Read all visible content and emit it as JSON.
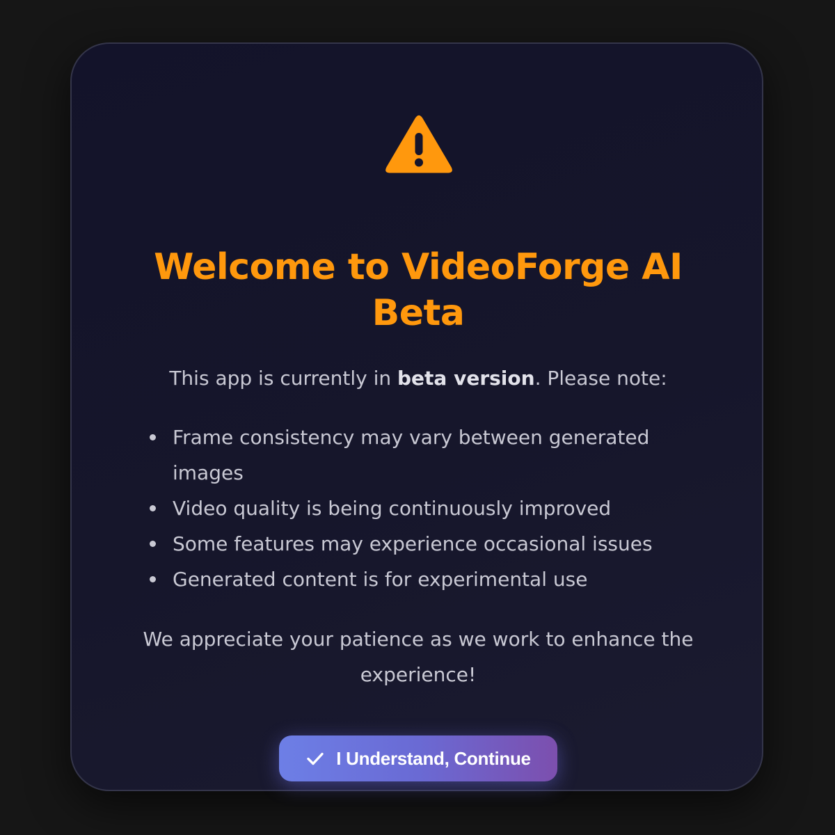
{
  "dialog": {
    "icon": "warning-triangle-icon",
    "title": "Welcome to VideoForge AI Beta",
    "intro_before": "This app is currently in ",
    "intro_bold": "beta version",
    "intro_after": ". Please note:",
    "notes": [
      "Frame consistency may vary between generated images",
      "Video quality is being continuously improved",
      "Some features may experience occasional issues",
      "Generated content is for experimental use"
    ],
    "closing": "We appreciate your patience as we work to enhance the experience!",
    "continue_button": {
      "icon": "check-icon",
      "label": "I Understand, Continue"
    }
  },
  "colors": {
    "accent": "#ff980d",
    "background": "#161616",
    "modal_bg": "#15152b",
    "text": "#c9c9d4",
    "button_gradient_start": "#6d7fe6",
    "button_gradient_end": "#7c4fae"
  }
}
